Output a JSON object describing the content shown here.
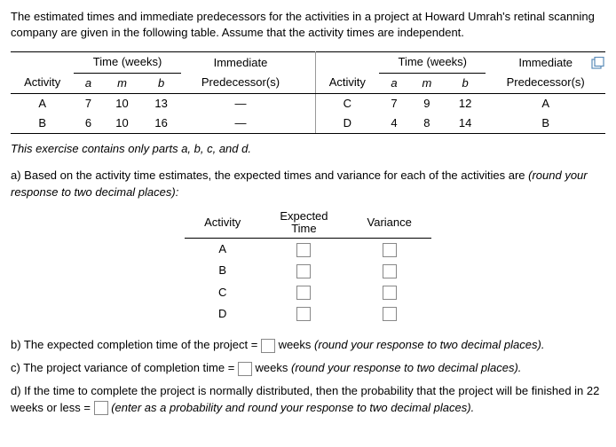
{
  "intro": "The estimated times and immediate predecessors for the activities in a project at Howard Umrah's retinal scanning company are given in the following table. Assume that the activity times are independent.",
  "table1": {
    "time_header": "Time (weeks)",
    "immediate_header": "Immediate",
    "activity_header": "Activity",
    "a_header": "a",
    "m_header": "m",
    "b_header": "b",
    "pred_header": "Predecessor(s)",
    "rows_left": [
      {
        "act": "A",
        "a": "7",
        "m": "10",
        "b": "13",
        "pred": "—"
      },
      {
        "act": "B",
        "a": "6",
        "m": "10",
        "b": "16",
        "pred": "—"
      }
    ],
    "rows_right": [
      {
        "act": "C",
        "a": "7",
        "m": "9",
        "b": "12",
        "pred": "A"
      },
      {
        "act": "D",
        "a": "4",
        "m": "8",
        "b": "14",
        "pred": "B"
      }
    ]
  },
  "note": "This exercise contains only parts a, b, c, and d.",
  "part_a": {
    "text1": "a) Based on the activity time estimates, the expected times and variance for each of the activities are ",
    "text2": "(round your response to two decimal places):",
    "col_activity": "Activity",
    "col_expected": "Expected Time",
    "col_variance": "Variance",
    "acts": [
      "A",
      "B",
      "C",
      "D"
    ]
  },
  "part_b": {
    "t1": "b) The expected completion time of the project = ",
    "t2": " weeks ",
    "t3": "(round your response to two decimal places)."
  },
  "part_c": {
    "t1": "c) The project variance of completion time = ",
    "t2": " weeks ",
    "t3": "(round your response to two decimal places)."
  },
  "part_d": {
    "t1": "d) If the time to complete the project is normally distributed, then the probability that the project will be finished in 22 weeks or less = ",
    "t2": " ",
    "t3": "(enter as a probability and round your response to two decimal places)."
  }
}
